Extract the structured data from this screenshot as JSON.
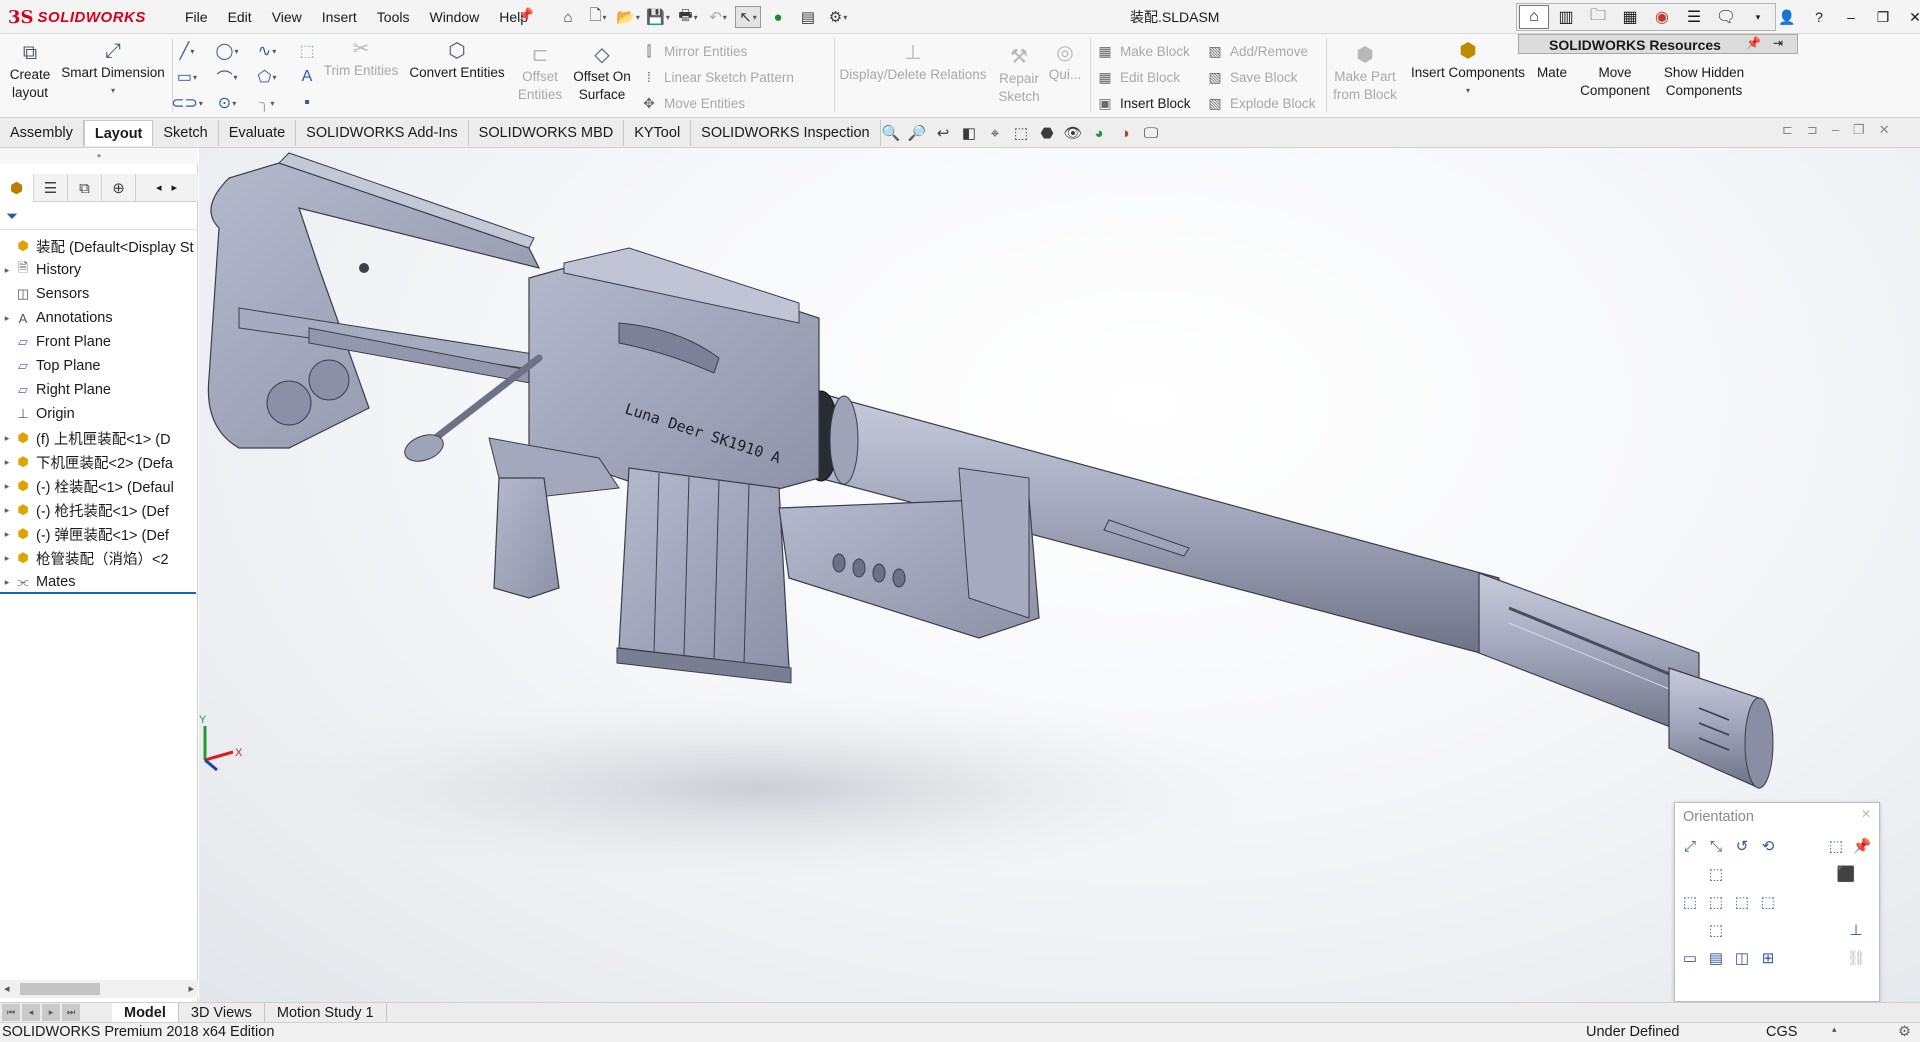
{
  "app": {
    "brand_ds": "3S",
    "brand_name": "SOLIDWORKS",
    "document_title": "装配.SLDASM"
  },
  "menu": [
    "File",
    "Edit",
    "View",
    "Insert",
    "Tools",
    "Window",
    "Help"
  ],
  "resources": {
    "label": "SOLIDWORKS Resources"
  },
  "ribbon": {
    "create_layout": "Create layout",
    "smart_dimension": "Smart Dimension",
    "trim_entities": "Trim Entities",
    "convert_entities": "Convert Entities",
    "offset_entities": "Offset Entities",
    "offset_on_surface": "Offset On Surface",
    "mirror_entities": "Mirror Entities",
    "linear_sketch_pattern": "Linear Sketch Pattern",
    "move_entities": "Move Entities",
    "display_delete_relations": "Display/Delete Relations",
    "repair_sketch": "Repair Sketch",
    "quick_snaps": "Qui...",
    "make_block": "Make Block",
    "edit_block": "Edit Block",
    "insert_block": "Insert Block",
    "add_remove": "Add/Remove",
    "save_block": "Save Block",
    "explode_block": "Explode Block",
    "make_part_from_block": "Make Part from Block",
    "insert_components": "Insert Components",
    "mate": "Mate",
    "move_component": "Move Component",
    "show_hidden_components": "Show Hidden Components"
  },
  "command_tabs": [
    {
      "label": "Assembly",
      "active": false
    },
    {
      "label": "Layout",
      "active": true
    },
    {
      "label": "Sketch",
      "active": false
    },
    {
      "label": "Evaluate",
      "active": false
    },
    {
      "label": "SOLIDWORKS Add-Ins",
      "active": false
    },
    {
      "label": "SOLIDWORKS MBD",
      "active": false
    },
    {
      "label": "KYTool",
      "active": false
    },
    {
      "label": "SOLIDWORKS Inspection",
      "active": false
    }
  ],
  "tree": [
    {
      "label": "装配  (Default<Display St",
      "icon": "assembly-icon",
      "expand": ""
    },
    {
      "label": "History",
      "icon": "history-icon",
      "expand": "▸"
    },
    {
      "label": "Sensors",
      "icon": "sensors-icon",
      "expand": ""
    },
    {
      "label": "Annotations",
      "icon": "annotations-icon",
      "expand": "▸"
    },
    {
      "label": "Front Plane",
      "icon": "plane-icon",
      "expand": ""
    },
    {
      "label": "Top Plane",
      "icon": "plane-icon",
      "expand": ""
    },
    {
      "label": "Right Plane",
      "icon": "plane-icon",
      "expand": ""
    },
    {
      "label": "Origin",
      "icon": "origin-icon",
      "expand": ""
    },
    {
      "label": "(f) 上机匣装配<1> (D",
      "icon": "assembly-icon",
      "expand": "▸"
    },
    {
      "label": "下机匣装配<2> (Defa",
      "icon": "assembly-icon",
      "expand": "▸"
    },
    {
      "label": "(-) 栓装配<1> (Defaul",
      "icon": "assembly-icon",
      "expand": "▸"
    },
    {
      "label": "(-) 枪托装配<1> (Def",
      "icon": "assembly-icon",
      "expand": "▸"
    },
    {
      "label": "(-) 弹匣装配<1> (Def",
      "icon": "assembly-icon",
      "expand": "▸"
    },
    {
      "label": "枪管装配（消焰）<2",
      "icon": "assembly-icon",
      "expand": "▸"
    },
    {
      "label": "Mates",
      "icon": "mates-icon",
      "expand": "▸"
    }
  ],
  "model": {
    "engraving": "Luna Deer SK1910 A"
  },
  "triad": {
    "y": "Y",
    "x": "X"
  },
  "orientation": {
    "title": "Orientation"
  },
  "bottom_tabs": [
    {
      "label": "Model",
      "active": true
    },
    {
      "label": "3D Views",
      "active": false
    },
    {
      "label": "Motion Study 1",
      "active": false
    }
  ],
  "status": {
    "edition": "SOLIDWORKS Premium 2018 x64 Edition",
    "definition": "Under Defined",
    "units": "CGS"
  },
  "colors": {
    "brand": "#d6001c",
    "accent": "#1c63b6",
    "model": "#9ea3b8"
  }
}
